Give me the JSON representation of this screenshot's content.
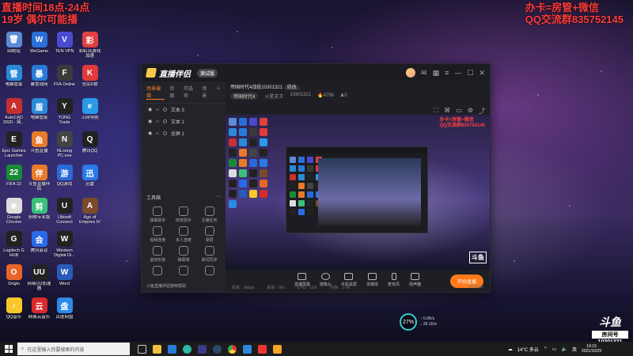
{
  "overlay": {
    "left_line1": "直播时间18点-24点",
    "left_line2": "19岁 偶尔可能播",
    "right_line1": "办卡=房管+微信",
    "right_line2": "QQ交流群835752145"
  },
  "desktop_icons": [
    {
      "label": "回收站",
      "color": "#5b8bd6",
      "glyph": "🗑"
    },
    {
      "label": "WeGame",
      "color": "#2a6fd8",
      "glyph": "W"
    },
    {
      "label": "TEN VPN",
      "color": "#4a4ad0",
      "glyph": "V"
    },
    {
      "label": "彩虹岛游戏加速",
      "color": "#e04040",
      "glyph": "彩"
    },
    {
      "label": "电脑管家",
      "color": "#2a8ad8",
      "glyph": "管"
    },
    {
      "label": "暴雪战网",
      "color": "#2a7ad8",
      "glyph": "暴"
    },
    {
      "label": "FFA Online",
      "color": "#3a3a3a",
      "glyph": "F"
    },
    {
      "label": "全民K歌",
      "color": "#e03a3a",
      "glyph": "K"
    },
    {
      "label": "AutoCAD 2020 - 简...",
      "color": "#c83030",
      "glyph": "A"
    },
    {
      "label": "电脑管家",
      "color": "#2a8ad8",
      "glyph": "盾"
    },
    {
      "label": "YUNG Trade",
      "color": "#222",
      "glyph": "Y"
    },
    {
      "label": "上网导航",
      "color": "#2a9ae8",
      "glyph": "e"
    },
    {
      "label": "Epic Games Launcher",
      "color": "#222",
      "glyph": "E"
    },
    {
      "label": "斗鱼直播",
      "color": "#e87a2a",
      "glyph": "鱼"
    },
    {
      "label": "NLoong PC.exe",
      "color": "#444",
      "glyph": "N"
    },
    {
      "label": "腾讯QQ",
      "color": "#222",
      "glyph": "Q"
    },
    {
      "label": "FIFA 22",
      "color": "#1a8a3a",
      "glyph": "22"
    },
    {
      "label": "斗鱼直播伴侣",
      "color": "#e87a2a",
      "glyph": "伴"
    },
    {
      "label": "QQ游戏",
      "color": "#2a6ad8",
      "glyph": "游"
    },
    {
      "label": "迅雷",
      "color": "#2a7ae8",
      "glyph": "迅"
    },
    {
      "label": "Google Chrome",
      "color": "#dddddd",
      "glyph": "◉"
    },
    {
      "label": "剪映专业版",
      "color": "#3ac07a",
      "glyph": "剪"
    },
    {
      "label": "Ubisoft Connect",
      "color": "#222",
      "glyph": "U"
    },
    {
      "label": "Age of Empires IV",
      "color": "#7a4a2a",
      "glyph": "A"
    },
    {
      "label": "Logitech G HUB",
      "color": "#222",
      "glyph": "G"
    },
    {
      "label": "腾讯会议",
      "color": "#2a6ae8",
      "glyph": "会"
    },
    {
      "label": "Western Digital Di...",
      "color": "#222",
      "glyph": "W"
    },
    {
      "label": "",
      "color": "transparent",
      "glyph": ""
    },
    {
      "label": "Origin",
      "color": "#e8642a",
      "glyph": "O"
    },
    {
      "label": "网易UU加速器",
      "color": "#222",
      "glyph": "UU"
    },
    {
      "label": "Word",
      "color": "#2a5ab8",
      "glyph": "W"
    },
    {
      "label": "",
      "color": "transparent",
      "glyph": ""
    },
    {
      "label": "QQ音乐",
      "color": "#f8c828",
      "glyph": "♪"
    },
    {
      "label": "网易云音乐",
      "color": "#d82a2a",
      "glyph": "云"
    },
    {
      "label": "百度网盘",
      "color": "#2a8ae8",
      "glyph": "盘"
    }
  ],
  "window": {
    "app_name": "直播伴侣",
    "version_badge": "测试版",
    "tabs": [
      "场景编辑",
      "页面",
      "可选项",
      "场景"
    ],
    "sources": [
      "文本 3",
      "文本 1",
      "全屏 1"
    ],
    "tools_header": "工具箱",
    "tools": [
      "弹幕助手",
      "房管助手",
      "主播任务",
      "视频连麦",
      "多人连麦",
      "录屏",
      "虚拟形象",
      "弹幕墙",
      "歌词同步",
      "",
      "",
      ""
    ],
    "left_footer": "斗鱼直播伴侣使用帮助",
    "stream_title": "帝国时代4战役10301321",
    "stream_tag": "修改",
    "category": "帝国时代4",
    "streamer": "火星支王",
    "room_id": "10301321",
    "heat": "4796",
    "fans": "0",
    "controls": [
      "直播屏幕",
      "摄像头",
      "手机投屏",
      "多媒体",
      "麦克风",
      "扬声器"
    ],
    "go_live": "开始直播",
    "status": [
      "码率：0kbps",
      "丢帧：0%",
      "CPU：12%",
      "内存：27%"
    ],
    "duration": "00:00:00"
  },
  "preview_overlay": {
    "line1": "办卡=房管+微信",
    "line2": "QQ交流群835752145"
  },
  "douyu": {
    "logo": "斗鱼",
    "label": "房间号",
    "room": "10301321"
  },
  "speed": {
    "cpu": "27",
    "unit": "%",
    "up": "0.0K/s",
    "down": "26.1K/s"
  },
  "taskbar": {
    "search_placeholder": "在这里输入你要搜索的内容",
    "temperature": "14°C 多云",
    "ime": "英",
    "time": "19:19",
    "date": "2021/10/29"
  }
}
